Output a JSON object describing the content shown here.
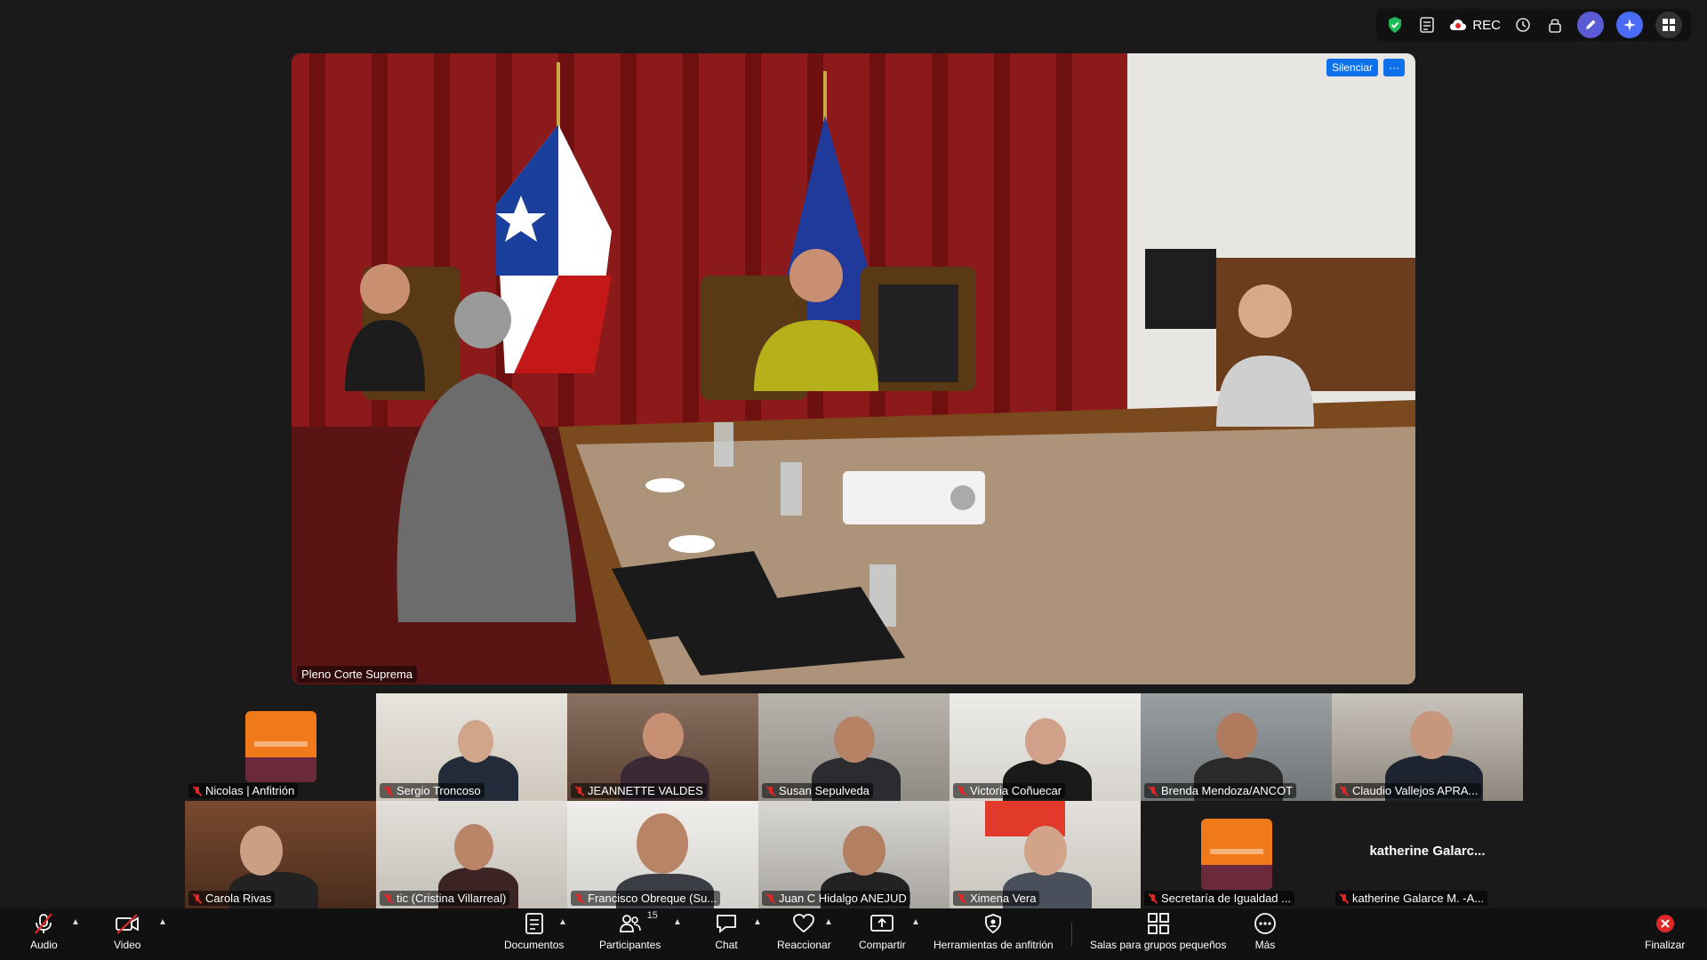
{
  "topbar": {
    "rec_label": "REC",
    "icons": [
      "shield-check-icon",
      "notes-icon",
      "cloud-record-icon",
      "timer-icon",
      "lock-icon",
      "pen-icon",
      "sparkle-icon",
      "apps-icon"
    ],
    "shield_color": "#1db954",
    "pen_color": "#5b5bd6",
    "sparkle_color": "#4a6cf7"
  },
  "speaker": {
    "name": "Pleno Corte Suprema",
    "mute_button": "Silenciar",
    "more_button": "···"
  },
  "participants": [
    {
      "name": "Nicolas | Anfitrión",
      "type": "logo"
    },
    {
      "name": "Sergio Troncoso",
      "type": "video"
    },
    {
      "name": "JEANNETTE VALDES",
      "type": "video"
    },
    {
      "name": "Susan Sepulveda",
      "type": "video"
    },
    {
      "name": "Victoria Coñuecar",
      "type": "video"
    },
    {
      "name": "Brenda Mendoza/ANCOT",
      "type": "video"
    },
    {
      "name": "Claudio Vallejos   APRA...",
      "type": "video"
    },
    {
      "name": "Carola Rivas",
      "type": "video"
    },
    {
      "name": "tic (Cristina Villarreal)",
      "type": "video"
    },
    {
      "name": "Francisco Obreque (Su...",
      "type": "video"
    },
    {
      "name": "Juan C Hidalgo ANEJUD",
      "type": "video"
    },
    {
      "name": "Ximena Vera",
      "type": "video"
    },
    {
      "name": "Secretaría de Igualdad ...",
      "type": "logo"
    },
    {
      "name": "katherine Galarce M. -A...",
      "type": "name",
      "display_name": "katherine  Galarc..."
    }
  ],
  "toolbar": {
    "audio": "Audio",
    "video": "Video",
    "documents": "Documentos",
    "participants": "Participantes",
    "participants_count": "15",
    "chat": "Chat",
    "react": "Reaccionar",
    "share": "Compartir",
    "host_tools": "Herramientas de anfitrión",
    "breakout": "Salas para grupos pequeños",
    "more": "Más",
    "end": "Finalizar",
    "end_color": "#e02828"
  }
}
